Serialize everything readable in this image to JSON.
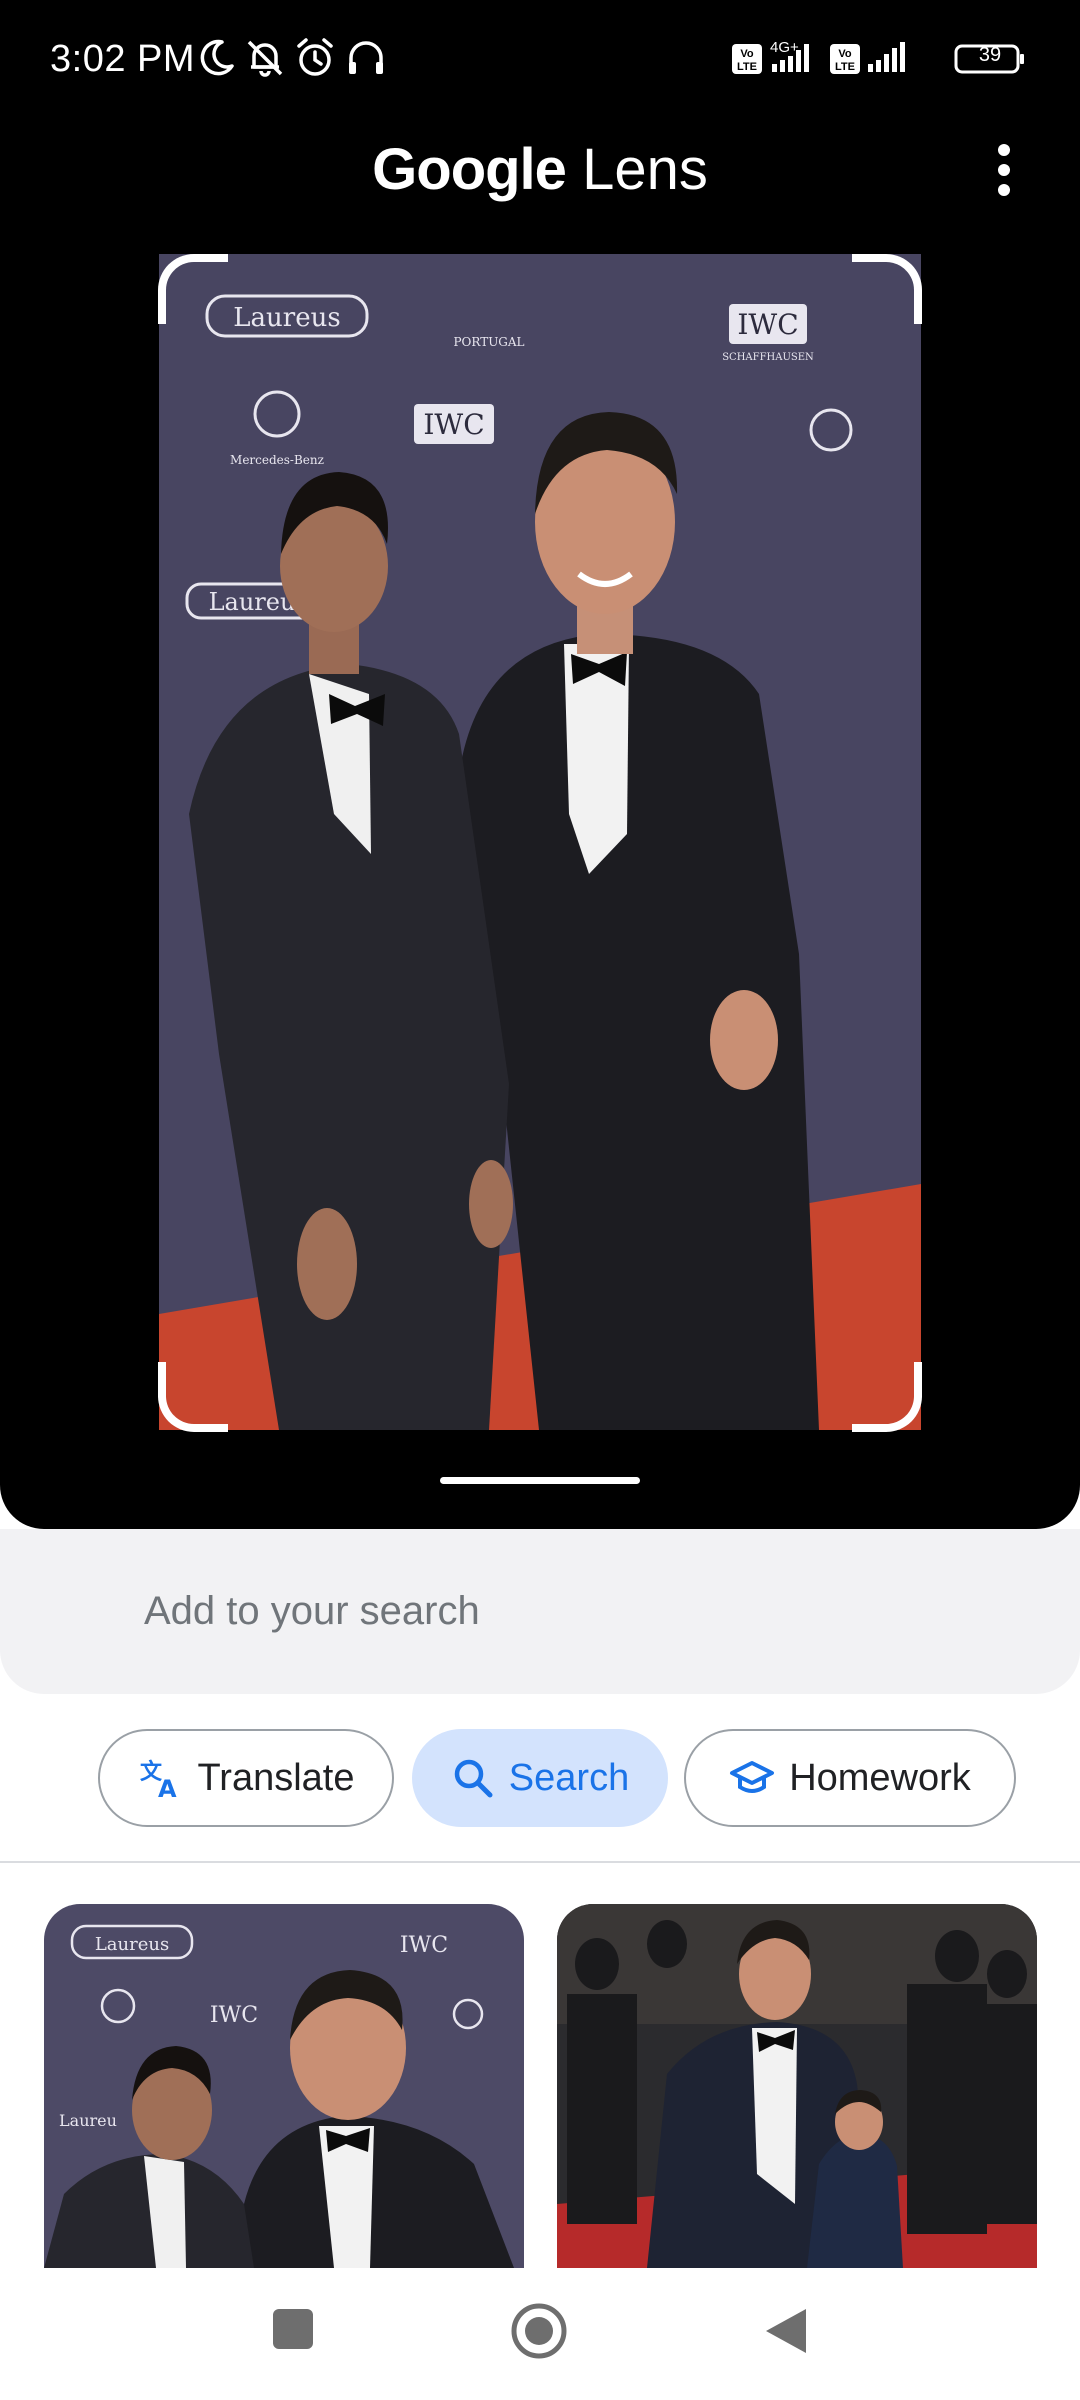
{
  "status_bar": {
    "time": "3:02 PM",
    "network_label": "4G+",
    "volte_label": "Vo LTE",
    "battery": "39",
    "icons": [
      "moon-icon",
      "bell-off-icon",
      "alarm-icon",
      "headphones-icon",
      "volte-icon",
      "signal-icon",
      "battery-icon"
    ]
  },
  "app_bar": {
    "title_brand": "Google",
    "title_product": "Lens"
  },
  "photo": {
    "backdrop_text": [
      "Laureus",
      "IWC",
      "SCHAFFHAUSEN",
      "Mercedes-Benz",
      "PORTUGAL"
    ]
  },
  "search": {
    "placeholder": "Add to your search"
  },
  "chips": [
    {
      "label": "Translate",
      "icon": "translate-icon",
      "selected": false
    },
    {
      "label": "Search",
      "icon": "search-icon",
      "selected": true
    },
    {
      "label": "Homework",
      "icon": "graduation-cap-icon",
      "selected": false
    }
  ],
  "colors": {
    "accent": "#1a73e8",
    "chip_selected_bg": "#d3e3fd",
    "backdrop": "#4a4560",
    "carpet": "#c8452e"
  },
  "results": [
    {
      "name": "result-image-1"
    },
    {
      "name": "result-image-2"
    }
  ],
  "nav": [
    "recents-button",
    "home-button",
    "back-button"
  ]
}
